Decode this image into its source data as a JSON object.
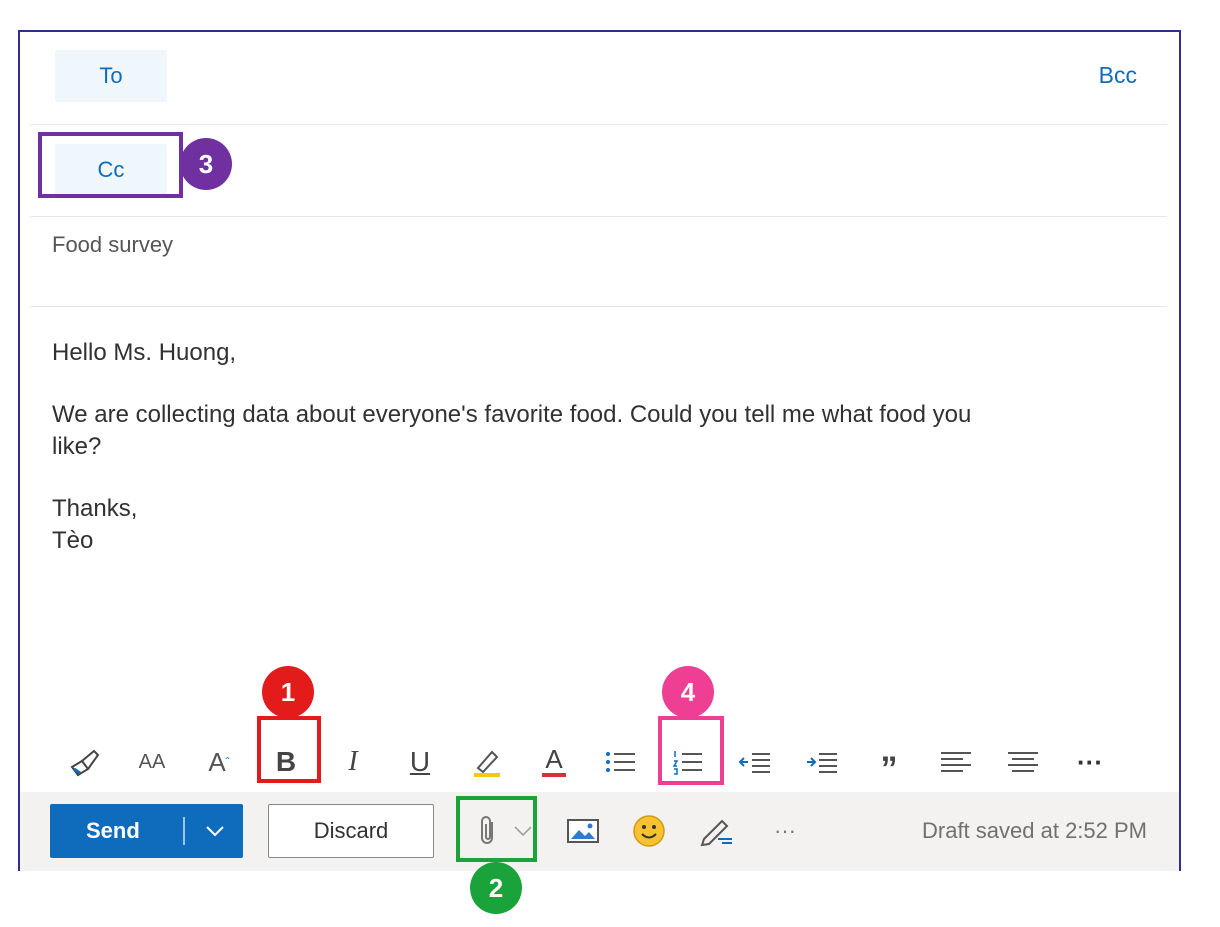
{
  "recipients": {
    "to_label": "To",
    "cc_label": "Cc",
    "bcc_label": "Bcc"
  },
  "subject": "Food survey",
  "body": {
    "greeting": "Hello Ms. Huong,",
    "paragraph_line1": "We are collecting data about everyone's favorite food. Could you tell me what food you",
    "paragraph_line2": "like?",
    "closing": "Thanks,",
    "signature": "Tèo"
  },
  "toolbar": {
    "icons": [
      "format-painter-icon",
      "font-size-icon",
      "grow-font-icon",
      "bold-icon",
      "italic-icon",
      "underline-icon",
      "highlight-icon",
      "font-color-icon",
      "bullets-icon",
      "numbering-icon",
      "decrease-indent-icon",
      "increase-indent-icon",
      "quote-icon",
      "align-left-icon",
      "align-center-icon",
      "more-options-icon"
    ],
    "font_size_glyph": "AA",
    "grow_font_glyph": "A",
    "bold_glyph": "B",
    "italic_glyph": "I",
    "underline_glyph": "U",
    "font_color_glyph": "A",
    "quote_glyph": "”",
    "more_glyph": "···"
  },
  "footer": {
    "send_label": "Send",
    "discard_label": "Discard",
    "more_glyph": "···",
    "status": "Draft saved at 2:52 PM"
  },
  "annotations": {
    "badge_1": "1",
    "badge_2": "2",
    "badge_3": "3",
    "badge_4": "4"
  },
  "colors": {
    "accent": "#0f6cbd",
    "badge_1": "#e31b1b",
    "badge_2": "#1aa33b",
    "badge_3": "#7030a0",
    "badge_4": "#ee3f95"
  }
}
